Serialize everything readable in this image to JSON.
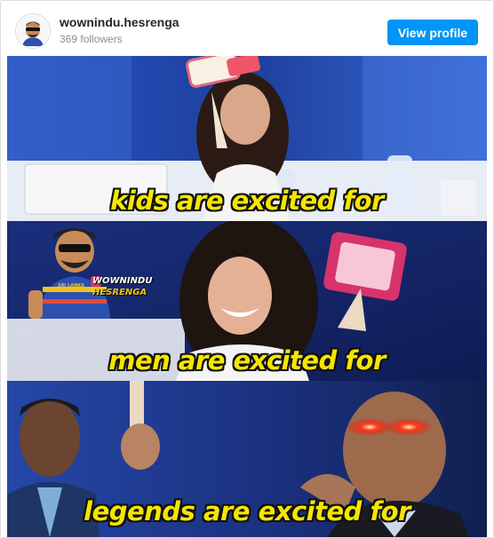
{
  "post": {
    "username": "wownindu.hesrenga",
    "followers": "369 followers",
    "view_profile_label": "View profile"
  },
  "meme": {
    "panels": [
      {
        "caption": "kids are excited for"
      },
      {
        "caption": "men are excited for"
      },
      {
        "caption": "legends are excited for"
      }
    ],
    "watermark": {
      "line1": "WOWNINDU",
      "line2": "HESRENGA",
      "badge": "SRI LANKA"
    }
  },
  "colors": {
    "button": "#0095f6",
    "caption": "#f5e600",
    "panel_bg": "#1f3fa8"
  }
}
